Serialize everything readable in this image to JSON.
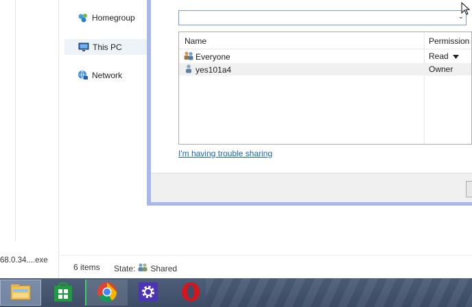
{
  "left_pane": {
    "file_name": "68.0.34....exe"
  },
  "nav": {
    "items": [
      {
        "label": "Homegroup",
        "icon": "homegroup-icon",
        "selected": false
      },
      {
        "label": "This PC",
        "icon": "computer-icon",
        "selected": true
      },
      {
        "label": "Network",
        "icon": "network-icon",
        "selected": false
      }
    ]
  },
  "status": {
    "item_count": "6 items",
    "state_label": "State:",
    "state_value": "Shared"
  },
  "share_dialog": {
    "combo_value": "",
    "columns": {
      "name": "Name",
      "permission": "Permission l"
    },
    "rows": [
      {
        "name": "Everyone",
        "permission": "Read",
        "has_dropdown": true,
        "icon": "group-icon"
      },
      {
        "name": "yes101a4",
        "permission": "Owner",
        "has_dropdown": false,
        "icon": "user-icon"
      }
    ],
    "trouble_link": "I'm having trouble sharing"
  },
  "taskbar": {
    "items": [
      {
        "name": "file-explorer",
        "icon": "folder-icon",
        "state": "active"
      },
      {
        "name": "store",
        "icon": "store-icon",
        "state": "normal"
      },
      {
        "name": "chrome",
        "icon": "chrome-icon",
        "state": "running"
      },
      {
        "name": "settings",
        "icon": "gear-icon",
        "state": "normal"
      },
      {
        "name": "opera",
        "icon": "opera-icon",
        "state": "normal"
      }
    ]
  },
  "colors": {
    "dialog_border": "#a8b8e8",
    "link": "#1565b5",
    "taskbar": "#46566f"
  }
}
